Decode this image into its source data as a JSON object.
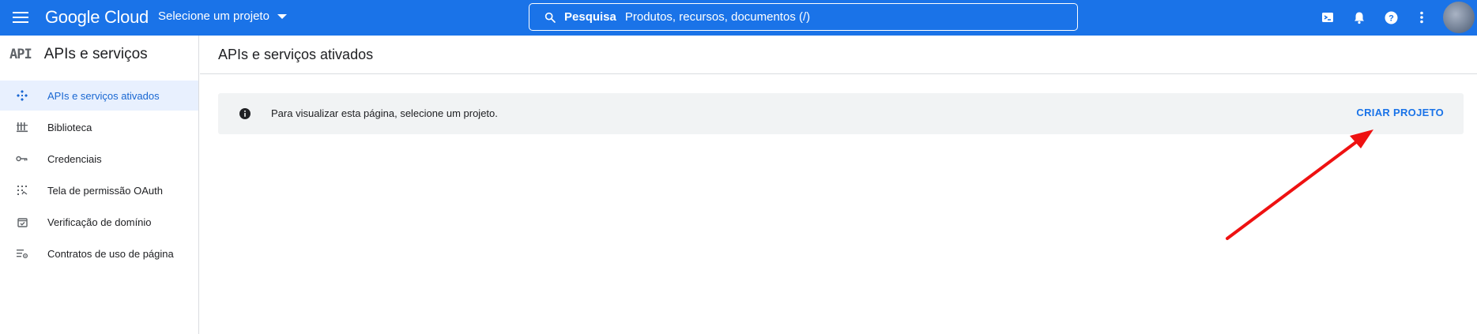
{
  "topbar": {
    "menu_icon": "hamburger-menu-icon",
    "logo": "Google Cloud",
    "project_selector": "Selecione um projeto",
    "search": {
      "label": "Pesquisa",
      "placeholder": "Produtos, recursos, documentos (/)"
    },
    "icons": [
      "cloud-shell-icon",
      "notifications-bell-icon",
      "help-icon",
      "more-vert-icon"
    ]
  },
  "sidebar": {
    "badge": "API",
    "title": "APIs e serviços",
    "items": [
      {
        "label": "APIs e serviços ativados",
        "icon": "apis-diamond-icon",
        "active": true
      },
      {
        "label": "Biblioteca",
        "icon": "library-icon",
        "active": false
      },
      {
        "label": "Credenciais",
        "icon": "key-icon",
        "active": false
      },
      {
        "label": "Tela de permissão OAuth",
        "icon": "oauth-consent-icon",
        "active": false
      },
      {
        "label": "Verificação de domínio",
        "icon": "domain-check-icon",
        "active": false
      },
      {
        "label": "Contratos de uso de página",
        "icon": "settings-list-icon",
        "active": false
      }
    ]
  },
  "main": {
    "title": "APIs e serviços ativados",
    "notice": {
      "icon": "info-icon",
      "text": "Para visualizar esta página, selecione um projeto.",
      "action": "CRIAR PROJETO"
    }
  },
  "colors": {
    "brand": "#1a73e8",
    "active_bg": "#e8f0fe",
    "active_text": "#1967d2",
    "annotation_arrow": "#ee1111"
  }
}
